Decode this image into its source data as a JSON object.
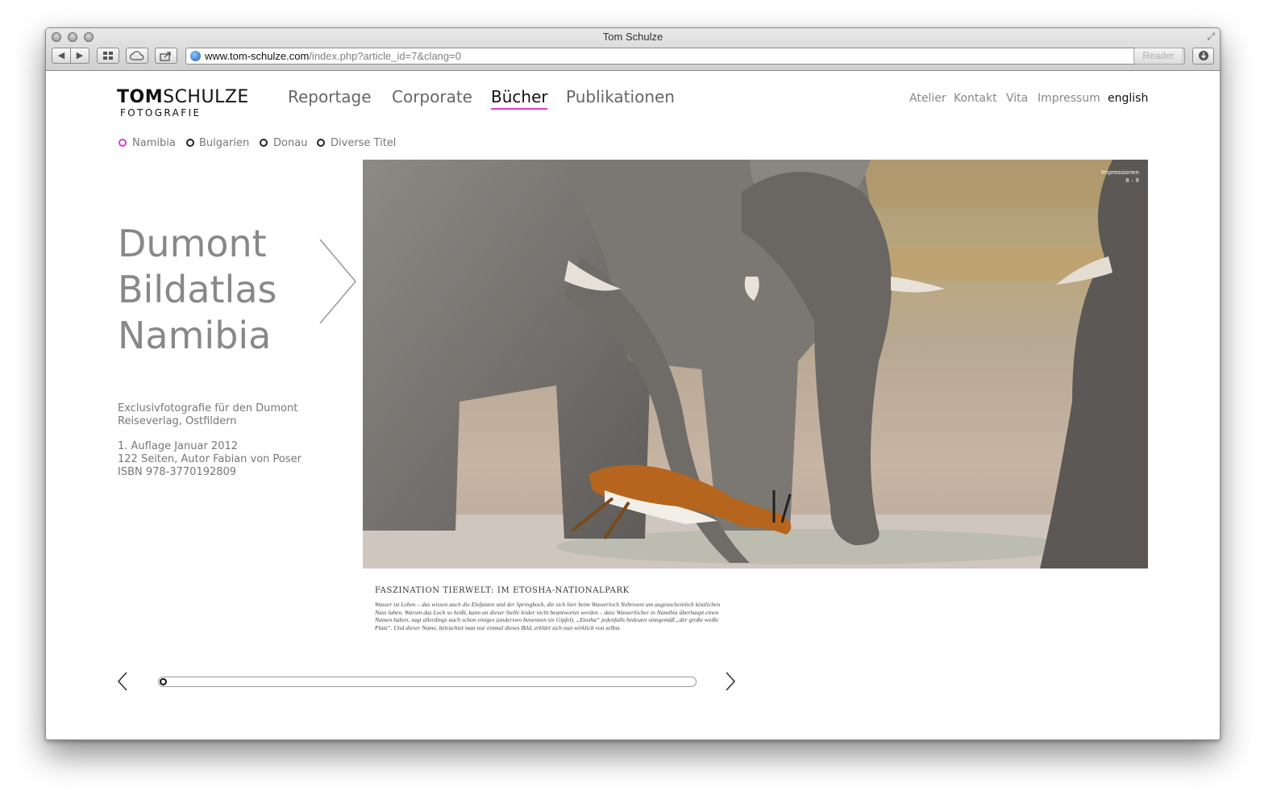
{
  "browser": {
    "window_title": "Tom Schulze",
    "url_domain": "www.tom-schulze.com",
    "url_path": "/index.php?article_id=7&clang=0",
    "reader_label": "Reader"
  },
  "logo": {
    "first": "TOM",
    "last": "SCHULZE",
    "sub": "FOTOGRAFIE"
  },
  "main_nav": [
    "Reportage",
    "Corporate",
    "Bücher",
    "Publikationen"
  ],
  "main_nav_active": "Bücher",
  "top_nav": [
    "Atelier",
    "Kontakt",
    "Vita",
    "Impressum",
    "english"
  ],
  "sub_nav": [
    "Namibia",
    "Bulgarien",
    "Donau",
    "Diverse Titel"
  ],
  "sub_nav_active": "Namibia",
  "book": {
    "title_lines": [
      "Dumont",
      "Bildatlas",
      "Namibia"
    ],
    "desc_1": "Exclusivfotografie für den Dumont",
    "desc_2": "Reiseverlag, Ostfildern",
    "edition": "1. Auflage Januar 2012",
    "pages_author": "122 Seiten, Autor Fabian von Poser",
    "isbn": "ISBN 978-3770192809"
  },
  "photo": {
    "page_label": "Impressionen",
    "page_numbers": "8 – 9",
    "caption_heading": "FASZINATION TIERWELT: IM ETOSHA-NATIONALPARK",
    "caption_text": "Wasser ist Leben – das wissen auch die Elefanten und der Springbock, die sich hier beim Wasserloch Nebrowni am augenscheinlich köstlichen Nass laben. Warum das Loch so heißt, kann an dieser Stelle leider nicht beantwortet werden – dass Wasserlöcher in Namibia überhaupt einen Namen haben, sagt allerdings auch schon einiges (anderswo benennen sie Gipfel). „Etosha“ jedenfalls bedeutet sinngemäß „der große weiße Platz“. Und dieser Name, betrachtet man nur einmal dieses Bild, erklärt sich nun wirklich von selbst."
  },
  "slider": {
    "position": 0
  },
  "colors": {
    "accent": "#e03ad6",
    "nav_text": "#666666",
    "title_text": "#888888"
  }
}
